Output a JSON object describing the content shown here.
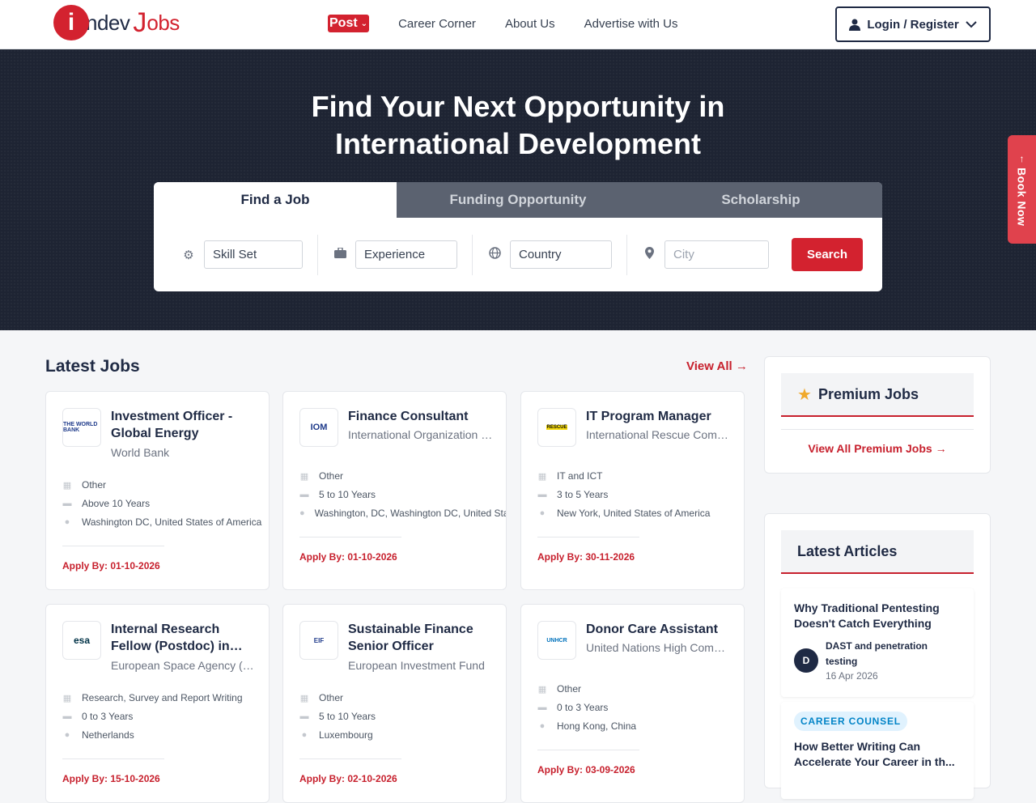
{
  "header": {
    "logo": {
      "part1": "ndev",
      "part2": "obs",
      "initial": "i",
      "j": "J"
    },
    "nav": {
      "post": "Post",
      "career": "Career Corner",
      "about": "About Us",
      "advertise": "Advertise with Us"
    },
    "login": "Login / Register"
  },
  "hero": {
    "title_line1": "Find Your Next Opportunity in",
    "title_line2": "International Development",
    "tabs": [
      "Find a Job",
      "Funding Opportunity",
      "Scholarship"
    ],
    "fields": {
      "skill": "Skill Set",
      "experience": "Experience",
      "country": "Country",
      "city": "City"
    },
    "search": "Search"
  },
  "book_now": "Book Now",
  "latest_jobs": {
    "title": "Latest Jobs",
    "view_all": "View All",
    "jobs": [
      {
        "title": "Investment Officer - Global Energy",
        "org": "World Bank",
        "category": "Other",
        "experience": "Above 10 Years",
        "location": "Washington DC, United States of America",
        "apply": "Apply By: 01-10-2026",
        "logo": "THE WORLD BANK"
      },
      {
        "title": "Finance Consultant",
        "org": "International Organization for Migration",
        "category": "Other",
        "experience": "5 to 10 Years",
        "location": "Washington, DC, Washington DC, United States",
        "apply": "Apply By: 01-10-2026",
        "logo": "IOM"
      },
      {
        "title": "IT Program Manager",
        "org": "International Rescue Committee",
        "category": "IT and ICT",
        "experience": "3 to 5 Years",
        "location": "New York, United States of America",
        "apply": "Apply By: 30-11-2026",
        "logo": "RESCUE"
      },
      {
        "title": "Internal Research Fellow (Postdoc) in Earth Observation",
        "org": "European Space Agency (ESA)",
        "category": "Research, Survey and Report Writing",
        "experience": "0 to 3 Years",
        "location": "Netherlands",
        "apply": "Apply By: 15-10-2026",
        "logo": "esa"
      },
      {
        "title": "Sustainable Finance Senior Officer",
        "org": "European Investment Fund",
        "category": "Other",
        "experience": "5 to 10 Years",
        "location": "Luxembourg",
        "apply": "Apply By: 02-10-2026",
        "logo": "EIF"
      },
      {
        "title": "Donor Care Assistant",
        "org": "United Nations High Commissioner for Refugees",
        "category": "Other",
        "experience": "0 to 3 Years",
        "location": "Hong Kong, China",
        "apply": "Apply By: 03-09-2026",
        "logo": "UNHCR"
      }
    ]
  },
  "premium": {
    "title": "Premium Jobs",
    "link": "View All Premium Jobs"
  },
  "articles": {
    "title": "Latest Articles",
    "items": [
      {
        "title": "Why Traditional Pentesting Doesn't Catch Everything",
        "author": "DAST and penetration testing",
        "date": "16 Apr 2026",
        "avatar": "D"
      },
      {
        "badge": "CAREER COUNSEL",
        "title": "How Better Writing Can Accelerate Your Career in th..."
      }
    ]
  },
  "colors": {
    "brand_red": "#d3222f",
    "navy": "#1f2a44",
    "hero_bg": "#1e2433"
  }
}
